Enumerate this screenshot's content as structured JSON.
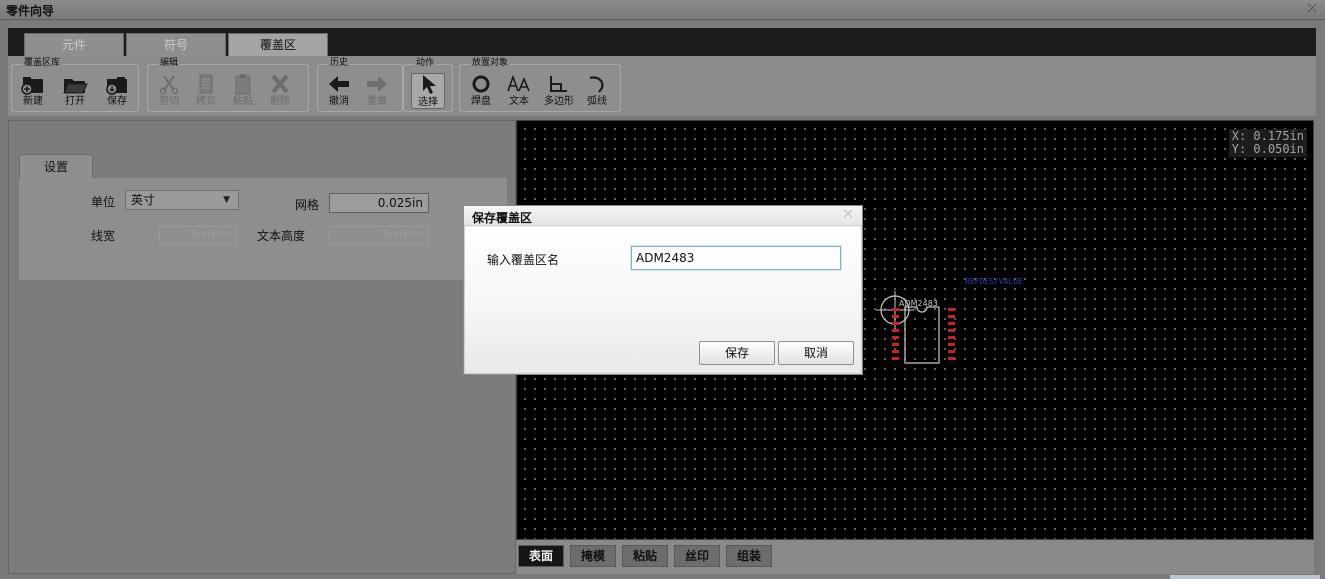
{
  "window": {
    "title": "零件向导",
    "close_glyph": "⤫"
  },
  "tabs": [
    {
      "label": "元件",
      "active": false
    },
    {
      "label": "符号",
      "active": false
    },
    {
      "label": "覆盖区",
      "active": true
    }
  ],
  "toolbar": {
    "groups": {
      "library": {
        "label": "覆盖区库",
        "buttons": [
          "新建",
          "打开",
          "保存"
        ]
      },
      "edit": {
        "label": "编辑",
        "buttons": [
          "剪切",
          "拷贝",
          "粘贴",
          "删除"
        ]
      },
      "history": {
        "label": "历史",
        "buttons": [
          "撤消",
          "重做"
        ]
      },
      "action": {
        "label": "动作",
        "buttons": [
          "选择"
        ]
      },
      "place": {
        "label": "放置对象",
        "buttons": [
          "焊盘",
          "文本",
          "多边形",
          "弧线"
        ]
      }
    }
  },
  "settings": {
    "tab_label": "设置",
    "unit_label": "单位",
    "unit_value": "英寸",
    "grid_label": "网格",
    "grid_value": "0.025in",
    "line_width_label": "线宽",
    "line_width_placeholder": "TextBox",
    "text_height_label": "文本高度",
    "text_height_placeholder": "TextBox"
  },
  "canvas": {
    "coord_x": "X: 0.175in",
    "coord_y": "Y: 0.050in",
    "component_label": "ADM2483",
    "ref_text": "REFDES/VALUE"
  },
  "layers": [
    {
      "label": "表面",
      "active": true
    },
    {
      "label": "掩模",
      "active": false
    },
    {
      "label": "粘贴",
      "active": false
    },
    {
      "label": "丝印",
      "active": false
    },
    {
      "label": "组装",
      "active": false
    }
  ],
  "dialog": {
    "title": "保存覆盖区",
    "field_label": "输入覆盖区名",
    "field_value": "ADM2483",
    "save_label": "保存",
    "cancel_label": "取消"
  },
  "colors": {
    "pad": "#cc2020",
    "ref_text": "#2a3fb0",
    "outline": "#c8c8c8"
  }
}
